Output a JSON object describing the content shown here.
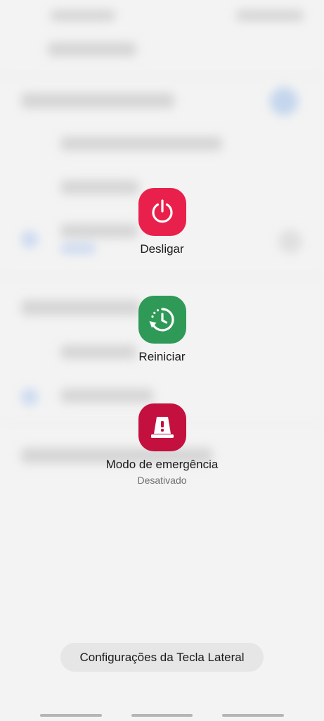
{
  "power_menu": {
    "options": [
      {
        "label": "Desligar",
        "icon": "power-icon",
        "color": "#e9204b"
      },
      {
        "label": "Reiniciar",
        "icon": "restart-icon",
        "color": "#2f9a57"
      },
      {
        "label": "Modo de emergência",
        "sublabel": "Desativado",
        "icon": "emergency-icon",
        "color": "#c4103f"
      }
    ]
  },
  "side_key_settings": {
    "label": "Configurações da Tecla Lateral"
  },
  "navigation_bar": {
    "buttons": [
      "recent-apps",
      "home",
      "back"
    ]
  }
}
